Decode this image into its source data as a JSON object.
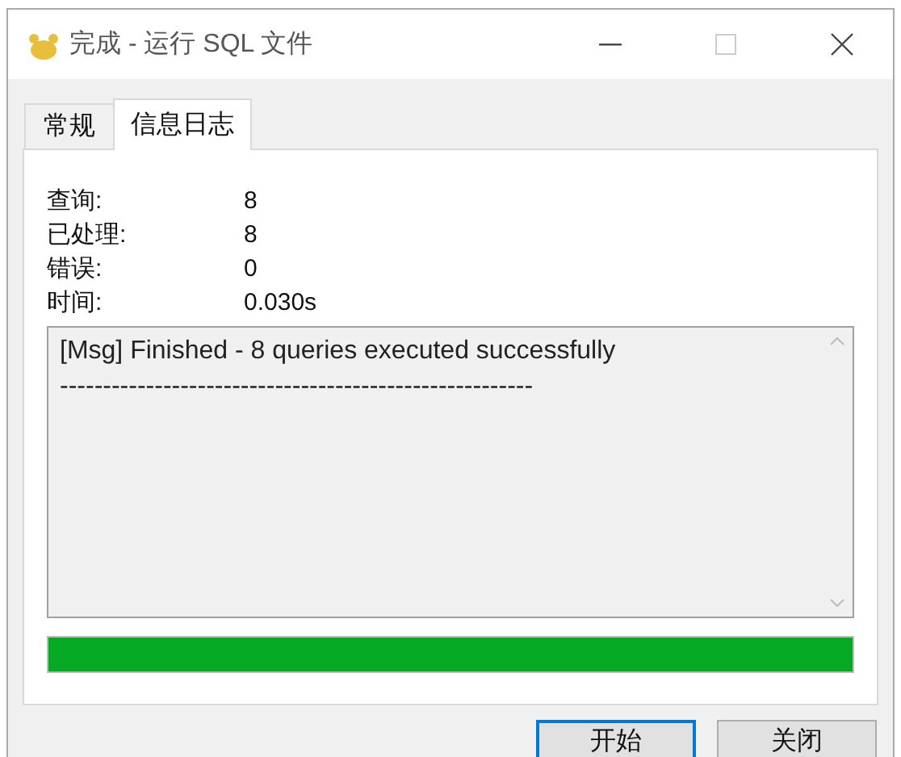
{
  "window": {
    "title": "完成 - 运行 SQL 文件"
  },
  "tabs": [
    {
      "label": "常规",
      "selected": false
    },
    {
      "label": "信息日志",
      "selected": true
    }
  ],
  "stats": [
    {
      "label": "查询:",
      "value": "8"
    },
    {
      "label": "已处理:",
      "value": "8"
    },
    {
      "label": "错误:",
      "value": "0"
    },
    {
      "label": "时间:",
      "value": "0.030s"
    }
  ],
  "log": {
    "lines": [
      "[Msg] Finished - 8 queries executed successfully",
      "-------------------------------------------------------"
    ]
  },
  "progress": {
    "level": 1
  },
  "buttons": [
    {
      "label": "开始",
      "focused": true
    },
    {
      "label": "关闭",
      "focused": false
    }
  ]
}
